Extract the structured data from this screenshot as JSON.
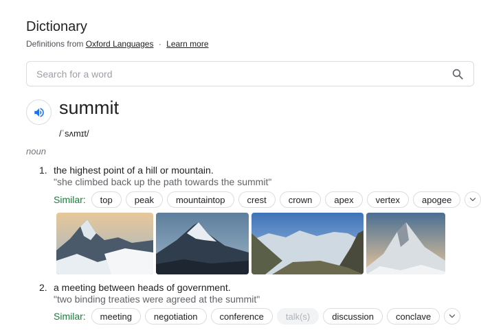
{
  "header": {
    "title": "Dictionary",
    "source_prefix": "Definitions from",
    "source_link": "Oxford Languages",
    "separator": "·",
    "learn_more": "Learn more"
  },
  "search": {
    "placeholder": "Search for a word",
    "value": ""
  },
  "entry": {
    "word": "summit",
    "phonetic": "/ˈsʌmɪt/",
    "part_of_speech": "noun",
    "senses": [
      {
        "number": "1.",
        "definition": "the highest point of a hill or mountain.",
        "example": "\"she climbed back up the path towards the summit\"",
        "similar_label": "Similar:",
        "similar": [
          "top",
          "peak",
          "mountaintop",
          "crest",
          "crown",
          "apex",
          "vertex",
          "apogee"
        ]
      },
      {
        "number": "2.",
        "definition": "a meeting between heads of government.",
        "example": "\"two binding treaties were agreed at the summit\"",
        "similar_label": "Similar:",
        "similar": [
          "meeting",
          "negotiation",
          "conference",
          "talk(s)",
          "discussion",
          "conclave"
        ],
        "disabled": [
          "talk(s)"
        ]
      }
    ]
  },
  "images": [
    {
      "icon": "mountain-photo-1"
    },
    {
      "icon": "mountain-photo-2"
    },
    {
      "icon": "mountain-photo-3"
    },
    {
      "icon": "mountain-photo-4"
    }
  ],
  "colors": {
    "similar_label": "#188038",
    "speaker": "#1a73e8"
  }
}
